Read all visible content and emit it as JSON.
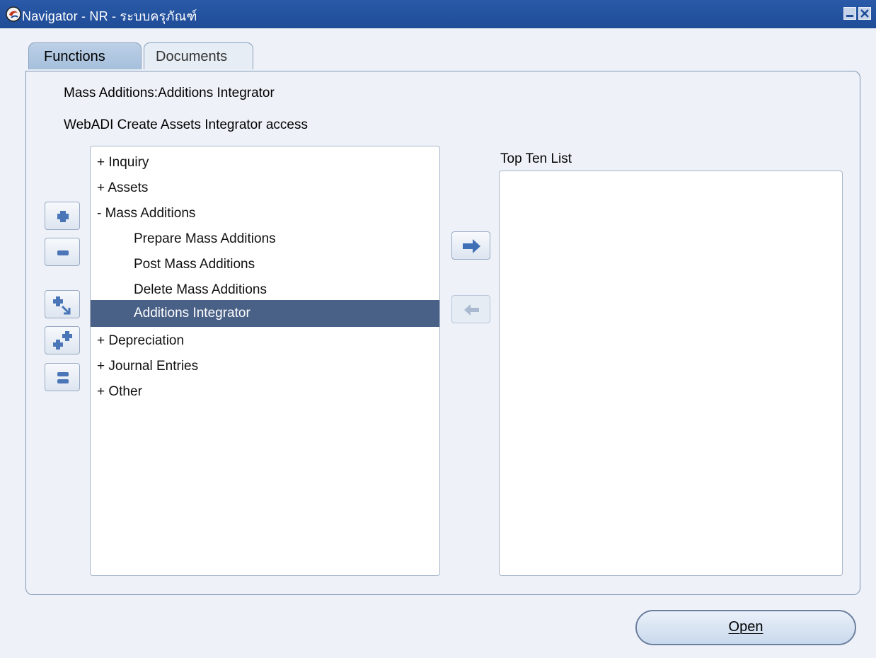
{
  "window": {
    "title": "Navigator - NR - ระบบครุภัณฑ์"
  },
  "tabs": [
    {
      "label": "Functions",
      "active": true
    },
    {
      "label": "Documents",
      "active": false
    }
  ],
  "info": {
    "line1": "Mass Additions:Additions Integrator",
    "line2": "WebADI Create Assets Integrator access"
  },
  "tree": {
    "items": [
      {
        "label": "+  Inquiry",
        "level": 0
      },
      {
        "label": "+  Assets",
        "level": 0
      },
      {
        "label": "-  Mass Additions",
        "level": 0
      },
      {
        "label": "Prepare Mass Additions",
        "level": 1
      },
      {
        "label": "Post Mass Additions",
        "level": 1
      },
      {
        "label": "Delete Mass Additions",
        "level": 1
      },
      {
        "label": "Additions Integrator",
        "level": 1,
        "selected": true
      },
      {
        "label": "+  Depreciation",
        "level": 0
      },
      {
        "label": "+  Journal Entries",
        "level": 0
      },
      {
        "label": "+  Other",
        "level": 0
      }
    ]
  },
  "tools": {
    "expand": "plus-icon",
    "collapse": "minus-icon",
    "expand_branch": "expand-branch-icon",
    "expand_all": "expand-all-icon",
    "collapse_all": "collapse-all-icon"
  },
  "top_ten": {
    "label": "Top Ten List",
    "items": []
  },
  "buttons": {
    "open_label": "Open",
    "add_icon": "right-arrow-icon",
    "remove_icon": "left-arrow-icon"
  },
  "colors": {
    "titlebar": "#2a5aa8",
    "selected_row": "#4a6187",
    "tab_active": "#bcd0e6"
  }
}
